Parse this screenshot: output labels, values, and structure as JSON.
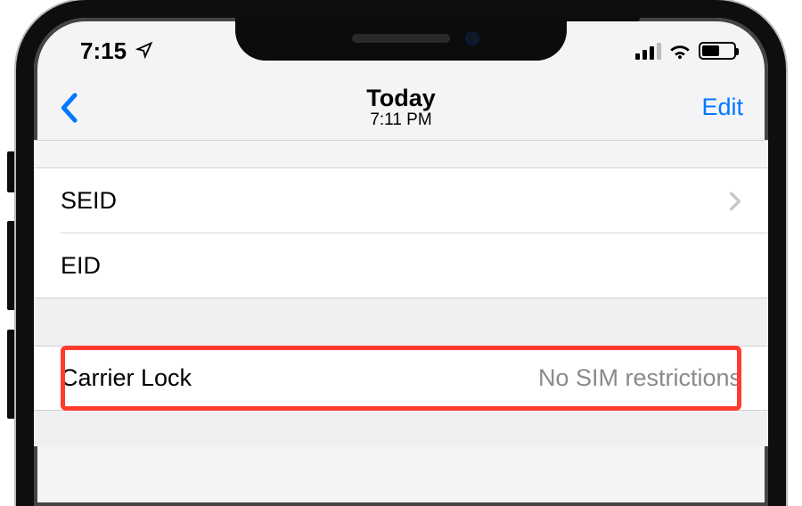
{
  "status": {
    "time": "7:15"
  },
  "nav": {
    "title": "Today",
    "subtitle": "7:11 PM",
    "edit": "Edit"
  },
  "rows": {
    "seid": {
      "label": "SEID"
    },
    "eid": {
      "label": "EID"
    },
    "carrier_lock": {
      "label": "Carrier Lock",
      "value": "No SIM restrictions"
    }
  }
}
